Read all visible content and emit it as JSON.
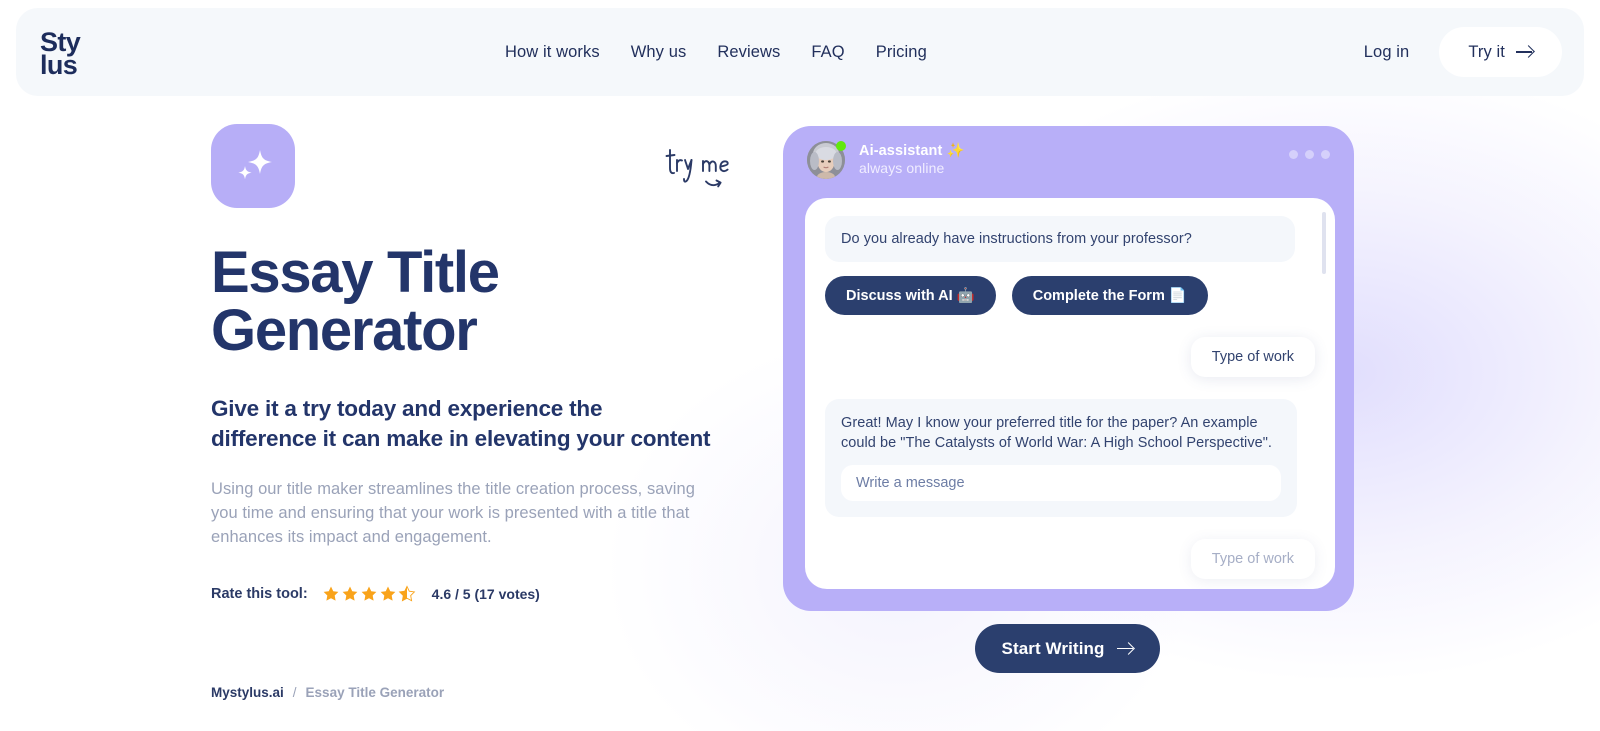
{
  "brand": {
    "logo_line1": "Sty",
    "logo_line2": "lus"
  },
  "header": {
    "nav": [
      {
        "label": "How it works"
      },
      {
        "label": "Why us"
      },
      {
        "label": "Reviews"
      },
      {
        "label": "FAQ"
      },
      {
        "label": "Pricing"
      }
    ],
    "login_label": "Log in",
    "cta_label": "Try it"
  },
  "hero": {
    "badge_icon": "sparkle-icon",
    "title_line1": "Essay Title",
    "title_line2": "Generator",
    "subtitle": "Give it a try today and experience the difference it can make in elevating your content",
    "description": "Using our title maker streamlines the title creation process, saving you time and ensuring that your work is presented with a title that enhances its impact and engagement.",
    "rating": {
      "label": "Rate this tool:",
      "stars_filled": 4,
      "stars_half": 1,
      "stars_total": 5,
      "value_text": "4.6 / 5 (17 votes)",
      "star_color": "#f9a31a"
    },
    "try_me_note": "try me"
  },
  "chat": {
    "assistant_name": "Ai-assistant ✨",
    "assistant_status": "always online",
    "window_dots": 3,
    "messages": [
      {
        "role": "assistant",
        "text": "Do you already have instructions from your professor?"
      },
      {
        "role": "user",
        "text": "Type of work"
      },
      {
        "role": "assistant",
        "text": "Great! May I know your preferred title for the paper? An example could be \"The Catalysts of World War: A High School Perspective\"."
      },
      {
        "role": "user",
        "text": "Type of work"
      }
    ],
    "quick_replies": [
      {
        "label": "Discuss with AI 🤖"
      },
      {
        "label": "Complete the Form 📄"
      }
    ],
    "input_placeholder": "Write a message",
    "accent_color": "#b8aff8"
  },
  "start_button": {
    "label": "Start Writing"
  },
  "breadcrumb": {
    "root": "Mystylus.ai",
    "separator": "/",
    "current": "Essay Title Generator"
  }
}
